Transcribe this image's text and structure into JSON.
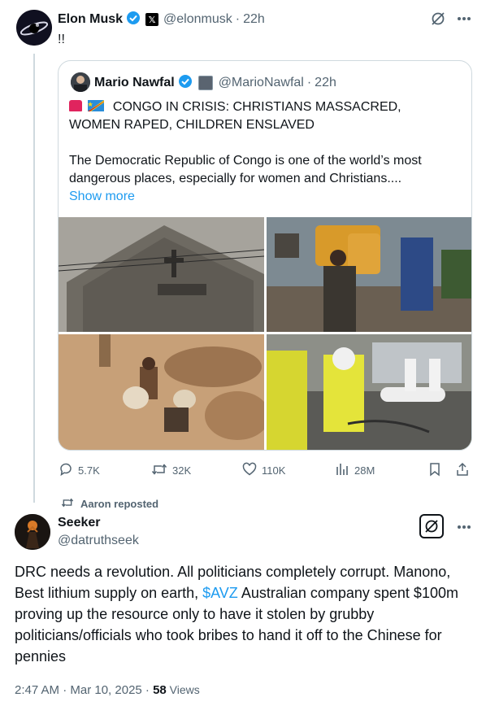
{
  "post": {
    "author_name": "Elon Musk",
    "author_handle": "@elonmusk",
    "time": "22h",
    "text": "!!"
  },
  "quote": {
    "author_name": "Mario Nawfal",
    "author_handle": "@MarioNawfal",
    "time": "22h",
    "headline_line1": "CONGO IN CRISIS: CHRISTIANS MASSACRED,",
    "headline_line2": "WOMEN RAPED, CHILDREN ENSLAVED",
    "body_line1": "The Democratic Republic of Congo is one of the world’s most",
    "body_line2": "dangerous places, especially for women and Christians....",
    "show_more": "Show more",
    "images": [
      {
        "name": "church-photo",
        "color": "#6d6a63"
      },
      {
        "name": "street-photo",
        "color": "#8a7a6c"
      },
      {
        "name": "mine-photo",
        "color": "#c49a6c"
      },
      {
        "name": "hazmat-photo",
        "color": "#b7bd4a"
      }
    ]
  },
  "actions": {
    "replies": "5.7K",
    "reposts": "32K",
    "likes": "110K",
    "views": "28M"
  },
  "repost_banner": "Aaron reposted",
  "reply": {
    "author_name": "Seeker",
    "author_handle": "@datruthseek",
    "text_before": "DRC needs a revolution. All politicians completely corrupt. Manono, Best lithium supply on earth, ",
    "cashtag": "$AVZ",
    "text_after": " Australian company spent $100m proving up the resource only to have it stolen by grubby politicians/officials who took bribes to hand it off to the Chinese for pennies",
    "timestamp": "2:47 AM · Mar 10, 2025 · ",
    "views_count": "58",
    "views_label": " Views"
  },
  "colors": {
    "accent": "#1d9bf0",
    "muted": "#536471",
    "border": "#cfd9de"
  }
}
